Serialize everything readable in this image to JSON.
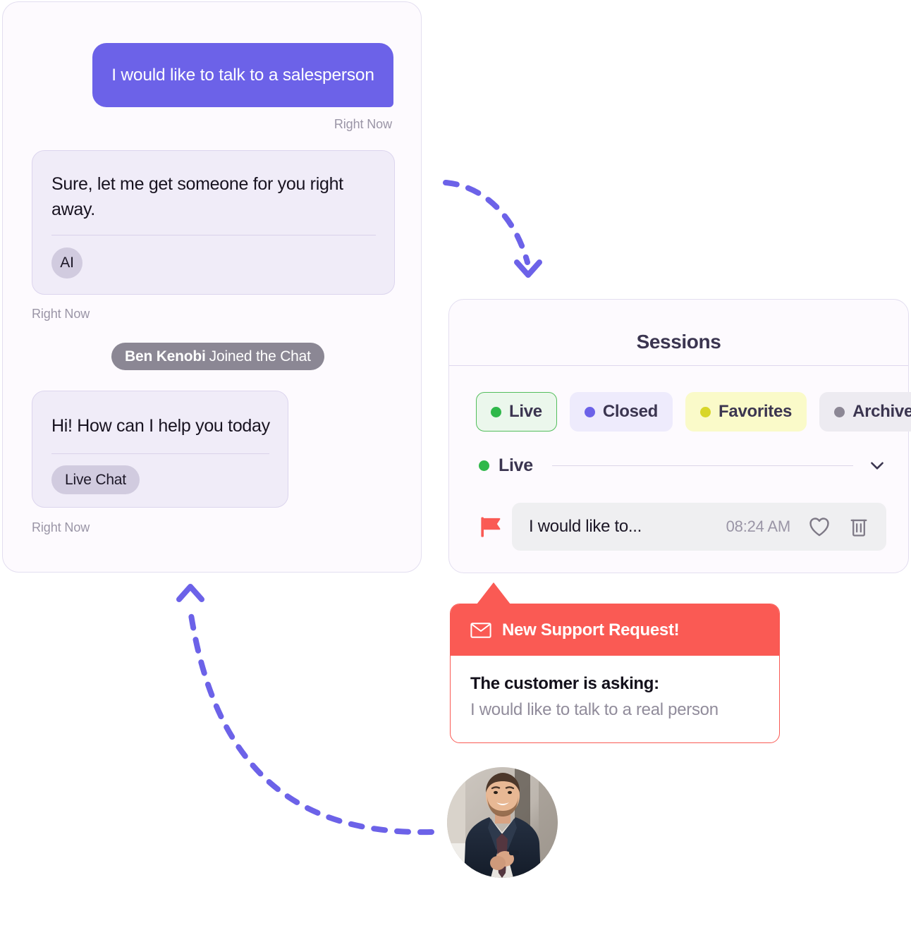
{
  "chat": {
    "user_message": "I would like to talk to a salesperson",
    "timestamp_1": "Right Now",
    "bot_message_1": "Sure, let me get someone for you right away.",
    "bot_tag_1": "AI",
    "timestamp_2": "Right Now",
    "joined_name": "Ben Kenobi",
    "joined_suffix": "Joined the Chat",
    "bot_message_2": "Hi! How can I help you today",
    "bot_tag_2": "Live Chat",
    "timestamp_3": "Right Now"
  },
  "sessions": {
    "title": "Sessions",
    "filters": [
      {
        "label": "Live",
        "dot_color": "#2FB84A",
        "bg": "#EBF7EC",
        "active": true
      },
      {
        "label": "Closed",
        "dot_color": "#6C62E8",
        "bg": "#EEEBFC",
        "active": false
      },
      {
        "label": "Favorites",
        "dot_color": "#D8D629",
        "bg": "#FAFAC9",
        "active": false
      },
      {
        "label": "Archived",
        "dot_color": "#8C8795",
        "bg": "#EDEBF1",
        "active": false
      }
    ],
    "group": {
      "label": "Live",
      "dot_color": "#2FB84A",
      "chevron": "chevron-down-icon"
    },
    "rows": [
      {
        "flag": "flag-icon",
        "snippet": "I would like to...",
        "time": "08:24 AM",
        "favorite_icon": "heart-icon",
        "delete_icon": "trash-icon"
      }
    ]
  },
  "notification": {
    "icon": "mail-icon",
    "title": "New Support Request!",
    "question_label": "The customer is asking:",
    "question_text": "I would like to talk to a real person",
    "accent_color": "#FA5A54"
  },
  "avatar": {
    "alt": "agent-photo"
  },
  "theme": {
    "purple": "#6C62E8",
    "red": "#FA5A54",
    "green": "#2FB84A",
    "panel_bg": "#FDFAFE",
    "bubble_bg": "#F0ECF8"
  }
}
